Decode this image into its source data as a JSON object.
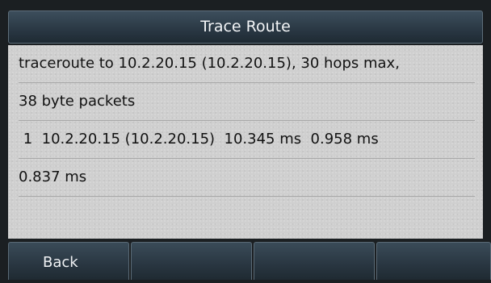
{
  "screen": {
    "title": "Trace Route"
  },
  "output": {
    "lines": [
      "traceroute to 10.2.20.15 (10.2.20.15), 30 hops max,",
      "38 byte packets",
      " 1  10.2.20.15 (10.2.20.15)  10.345 ms  0.958 ms",
      "0.837 ms"
    ]
  },
  "softkeys": [
    {
      "label": "Back"
    },
    {
      "label": ""
    },
    {
      "label": ""
    },
    {
      "label": ""
    }
  ]
}
